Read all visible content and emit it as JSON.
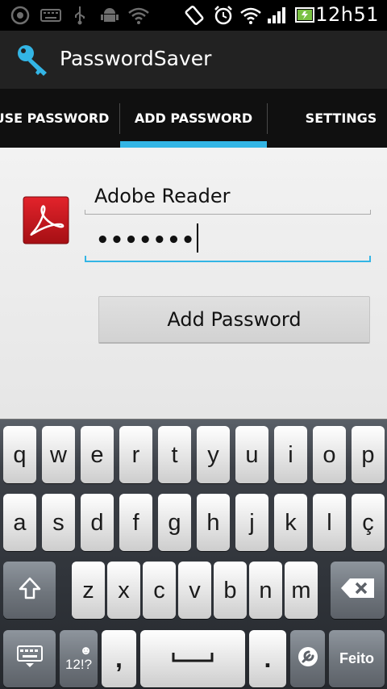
{
  "status_bar": {
    "time": "12h51",
    "icons": [
      "screenshot-icon",
      "keyboard-notification-icon",
      "usb-icon",
      "android-debug-icon",
      "wifi-notification-icon",
      "rotation-lock-icon",
      "alarm-icon",
      "wifi-signal-icon",
      "cell-signal-icon",
      "battery-icon"
    ]
  },
  "app": {
    "title": "PasswordSaver",
    "icon": "key-icon"
  },
  "tabs": [
    {
      "label": "USE PASSWORD",
      "selected": false
    },
    {
      "label": "ADD PASSWORD",
      "selected": true
    },
    {
      "label": "SETTINGS",
      "selected": false
    }
  ],
  "accent_color": "#33b5e5",
  "form": {
    "app_icon": "adobe-reader-icon",
    "name_value": "Adobe Reader",
    "password_mask": "•••••••",
    "add_button_label": "Add Password"
  },
  "keyboard": {
    "row1": [
      "q",
      "w",
      "e",
      "r",
      "t",
      "y",
      "u",
      "i",
      "o",
      "p"
    ],
    "row2": [
      "a",
      "s",
      "d",
      "f",
      "g",
      "h",
      "j",
      "k",
      "l",
      "ç"
    ],
    "row3": [
      "z",
      "x",
      "c",
      "v",
      "b",
      "n",
      "m"
    ],
    "symbols_label": "12!?",
    "comma": ",",
    "period": ".",
    "done_label": "Feito",
    "icons": [
      "shift-icon",
      "backspace-icon",
      "keyboard-settings-icon",
      "emoji-icon",
      "space-icon",
      "tools-icon"
    ]
  }
}
